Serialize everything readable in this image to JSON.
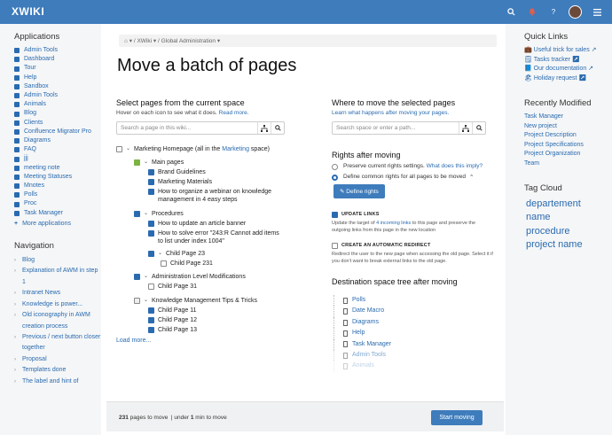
{
  "topbar": {
    "logo": "XWIKI"
  },
  "left": {
    "applications_title": "Applications",
    "apps": [
      "Admin Tools",
      "Dashboard",
      "Tour",
      "Help",
      "Sandbox",
      "Admin Tools",
      "Animals",
      "Blog",
      "Clients",
      "Confluence Migrator Pro",
      "Diagrams",
      "FAQ",
      "jjj",
      "meeting note",
      "Meeting Statuses",
      "Mnotes",
      "Polls",
      "Proc",
      "Task Manager"
    ],
    "more_apps": "More applications",
    "navigation_title": "Navigation",
    "nav": [
      "Blog",
      "Explanation of AWM in step 1",
      "Intranet News",
      "Knowledge is power...",
      "Old iconography in AWM creation process",
      "Previous / next button closer together",
      "Proposal",
      "Templates done",
      "The label and hint of"
    ]
  },
  "breadcrumb": {
    "home": "⌂",
    "xwiki": "XWiki",
    "sep": "/",
    "page": "Global Administration"
  },
  "main": {
    "title": "Move a batch of pages",
    "select_heading": "Select pages from the current space",
    "select_sub": "Hover on each icon to see what it does.",
    "read_more": "Read more.",
    "search_placeholder": "Search a page in this wiki...",
    "tree": {
      "root": "Marketing Homepage (all in the",
      "root_link": "Marketing",
      "root_suffix": "space)",
      "main_pages": "Main pages",
      "brand": "Brand Guidelines",
      "materials": "Marketing Materials",
      "webinar": "How to organize a webinar on knowledge management in 4 easy steps",
      "procedures": "Procedures",
      "article": "How to update an article banner",
      "error": "How to solve error \"243:R Cannot  add items to list under index 1004\"",
      "child23": "Child Page 23",
      "child231": "Child Page 231",
      "admin_mod": "Administration Level Modifications",
      "child31": "Child Page 31",
      "km_tips": "Knowledge Management Tips & Tricks",
      "child11": "Child Page 11",
      "child12": "Child Page 12",
      "child13": "Child Page 13",
      "load_more": "Load more..."
    },
    "where_heading": "Where to move the selected pages",
    "where_link": "Learn what happens after moving your pages.",
    "where_placeholder": "Search space or enter a path...",
    "rights_heading": "Rights after moving",
    "preserve": "Preserve current rights settings.",
    "preserve_link": "What does this imply?",
    "define_common": "Define common rights for all pages to be moved",
    "define_btn": "Define rights",
    "update_links_h": "UPDATE LINKS",
    "update_links_d1": "Update the target of",
    "update_links_link": "4 incoming links",
    "update_links_d2": "to this page and preserve the outgoing links from this page in the new location",
    "redirect_h": "CREATE AN AUTOMATIC REDIRECT",
    "redirect_d": "Redirect the user to the new page when accessing the old page. Select it if you don't want to break external links to the old page.",
    "dest_heading": "Destination space tree after moving",
    "dest": [
      "Polls",
      "Date Macro",
      "Diagrams",
      "Help",
      "Task Manager",
      "Admin Tools",
      "Animals"
    ],
    "footer_count": "231",
    "footer_pages": "pages to move",
    "footer_under": "under",
    "footer_min": "1",
    "footer_min_txt": "min to move",
    "start_btn": "Start moving"
  },
  "right": {
    "quick_title": "Quick Links",
    "quick": [
      "Useful trick for sales",
      "Tasks tracker",
      "Our documentation",
      "Holiday request"
    ],
    "recent_title": "Recently Modified",
    "recent": [
      "Task Manager",
      "New project",
      "Project Description",
      "Project Specifications",
      "Project Organization",
      "Team"
    ],
    "tag_title": "Tag Cloud",
    "tags": [
      "departement",
      "name",
      "procedure",
      "project name"
    ]
  }
}
